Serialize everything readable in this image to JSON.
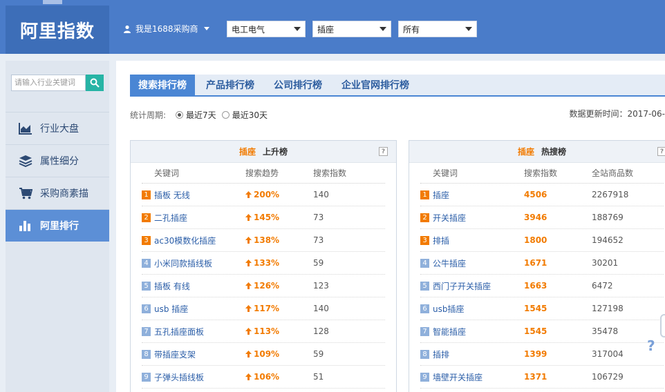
{
  "brand": {
    "logo_text": "阿里指数",
    "accent": "#4a7cc9",
    "highlight": "#f27b00",
    "search_button": "#27b4a5"
  },
  "header": {
    "user_label": "我是1688采购商",
    "selects": [
      {
        "value": "电工电气"
      },
      {
        "value": "插座"
      },
      {
        "value": "所有"
      }
    ]
  },
  "sidebar": {
    "search_placeholder": "请输入行业关键词",
    "items": [
      {
        "label": "行业大盘",
        "icon": "area-chart-icon",
        "active": false
      },
      {
        "label": "属性细分",
        "icon": "layers-icon",
        "active": false
      },
      {
        "label": "采购商素描",
        "icon": "cart-icon",
        "active": false
      },
      {
        "label": "阿里排行",
        "icon": "bar-chart-icon",
        "active": true
      }
    ]
  },
  "main": {
    "tabs": [
      {
        "label": "搜索排行榜",
        "active": true
      },
      {
        "label": "产品排行榜",
        "active": false
      },
      {
        "label": "公司排行榜",
        "active": false
      },
      {
        "label": "企业官网排行榜",
        "active": false
      }
    ],
    "period": {
      "label": "统计周期:",
      "options": [
        {
          "label": "最近7天",
          "selected": true
        },
        {
          "label": "最近30天",
          "selected": false
        }
      ]
    },
    "updated_text": "数据更新时间：2017-06-"
  },
  "rising": {
    "keyword": "插座",
    "title": "上升榜",
    "help": "?",
    "columns": [
      "关键词",
      "搜索趋势",
      "搜索指数"
    ],
    "rows": [
      {
        "rank": "1",
        "keyword": "插板 无线",
        "trend": "200%",
        "index": "140"
      },
      {
        "rank": "2",
        "keyword": "二孔插座",
        "trend": "145%",
        "index": "73"
      },
      {
        "rank": "3",
        "keyword": "ac30模数化插座",
        "trend": "138%",
        "index": "73"
      },
      {
        "rank": "4",
        "keyword": "小米同款插线板",
        "trend": "133%",
        "index": "59"
      },
      {
        "rank": "5",
        "keyword": "插板 有线",
        "trend": "126%",
        "index": "123"
      },
      {
        "rank": "6",
        "keyword": "usb 插座",
        "trend": "117%",
        "index": "140"
      },
      {
        "rank": "7",
        "keyword": "五孔插座面板",
        "trend": "113%",
        "index": "128"
      },
      {
        "rank": "8",
        "keyword": "带插座支架",
        "trend": "109%",
        "index": "59"
      },
      {
        "rank": "9",
        "keyword": "子弹头插线板",
        "trend": "106%",
        "index": "51"
      }
    ]
  },
  "hot": {
    "keyword": "插座",
    "title": "热搜榜",
    "help": "?",
    "columns": [
      "关键词",
      "搜索指数",
      "全站商品数"
    ],
    "rows": [
      {
        "rank": "1",
        "keyword": "插座",
        "index": "4506",
        "count": "2267918"
      },
      {
        "rank": "2",
        "keyword": "开关插座",
        "index": "3946",
        "count": "188769"
      },
      {
        "rank": "3",
        "keyword": "排插",
        "index": "1800",
        "count": "194652"
      },
      {
        "rank": "4",
        "keyword": "公牛插座",
        "index": "1671",
        "count": "30201"
      },
      {
        "rank": "5",
        "keyword": "西门子开关插座",
        "index": "1663",
        "count": "6472"
      },
      {
        "rank": "6",
        "keyword": "usb插座",
        "index": "1545",
        "count": "127198"
      },
      {
        "rank": "7",
        "keyword": "智能插座",
        "index": "1545",
        "count": "35478"
      },
      {
        "rank": "8",
        "keyword": "插排",
        "index": "1399",
        "count": "317004"
      },
      {
        "rank": "9",
        "keyword": "墙壁开关插座",
        "index": "1371",
        "count": "106729"
      }
    ]
  },
  "floating_help": "?"
}
